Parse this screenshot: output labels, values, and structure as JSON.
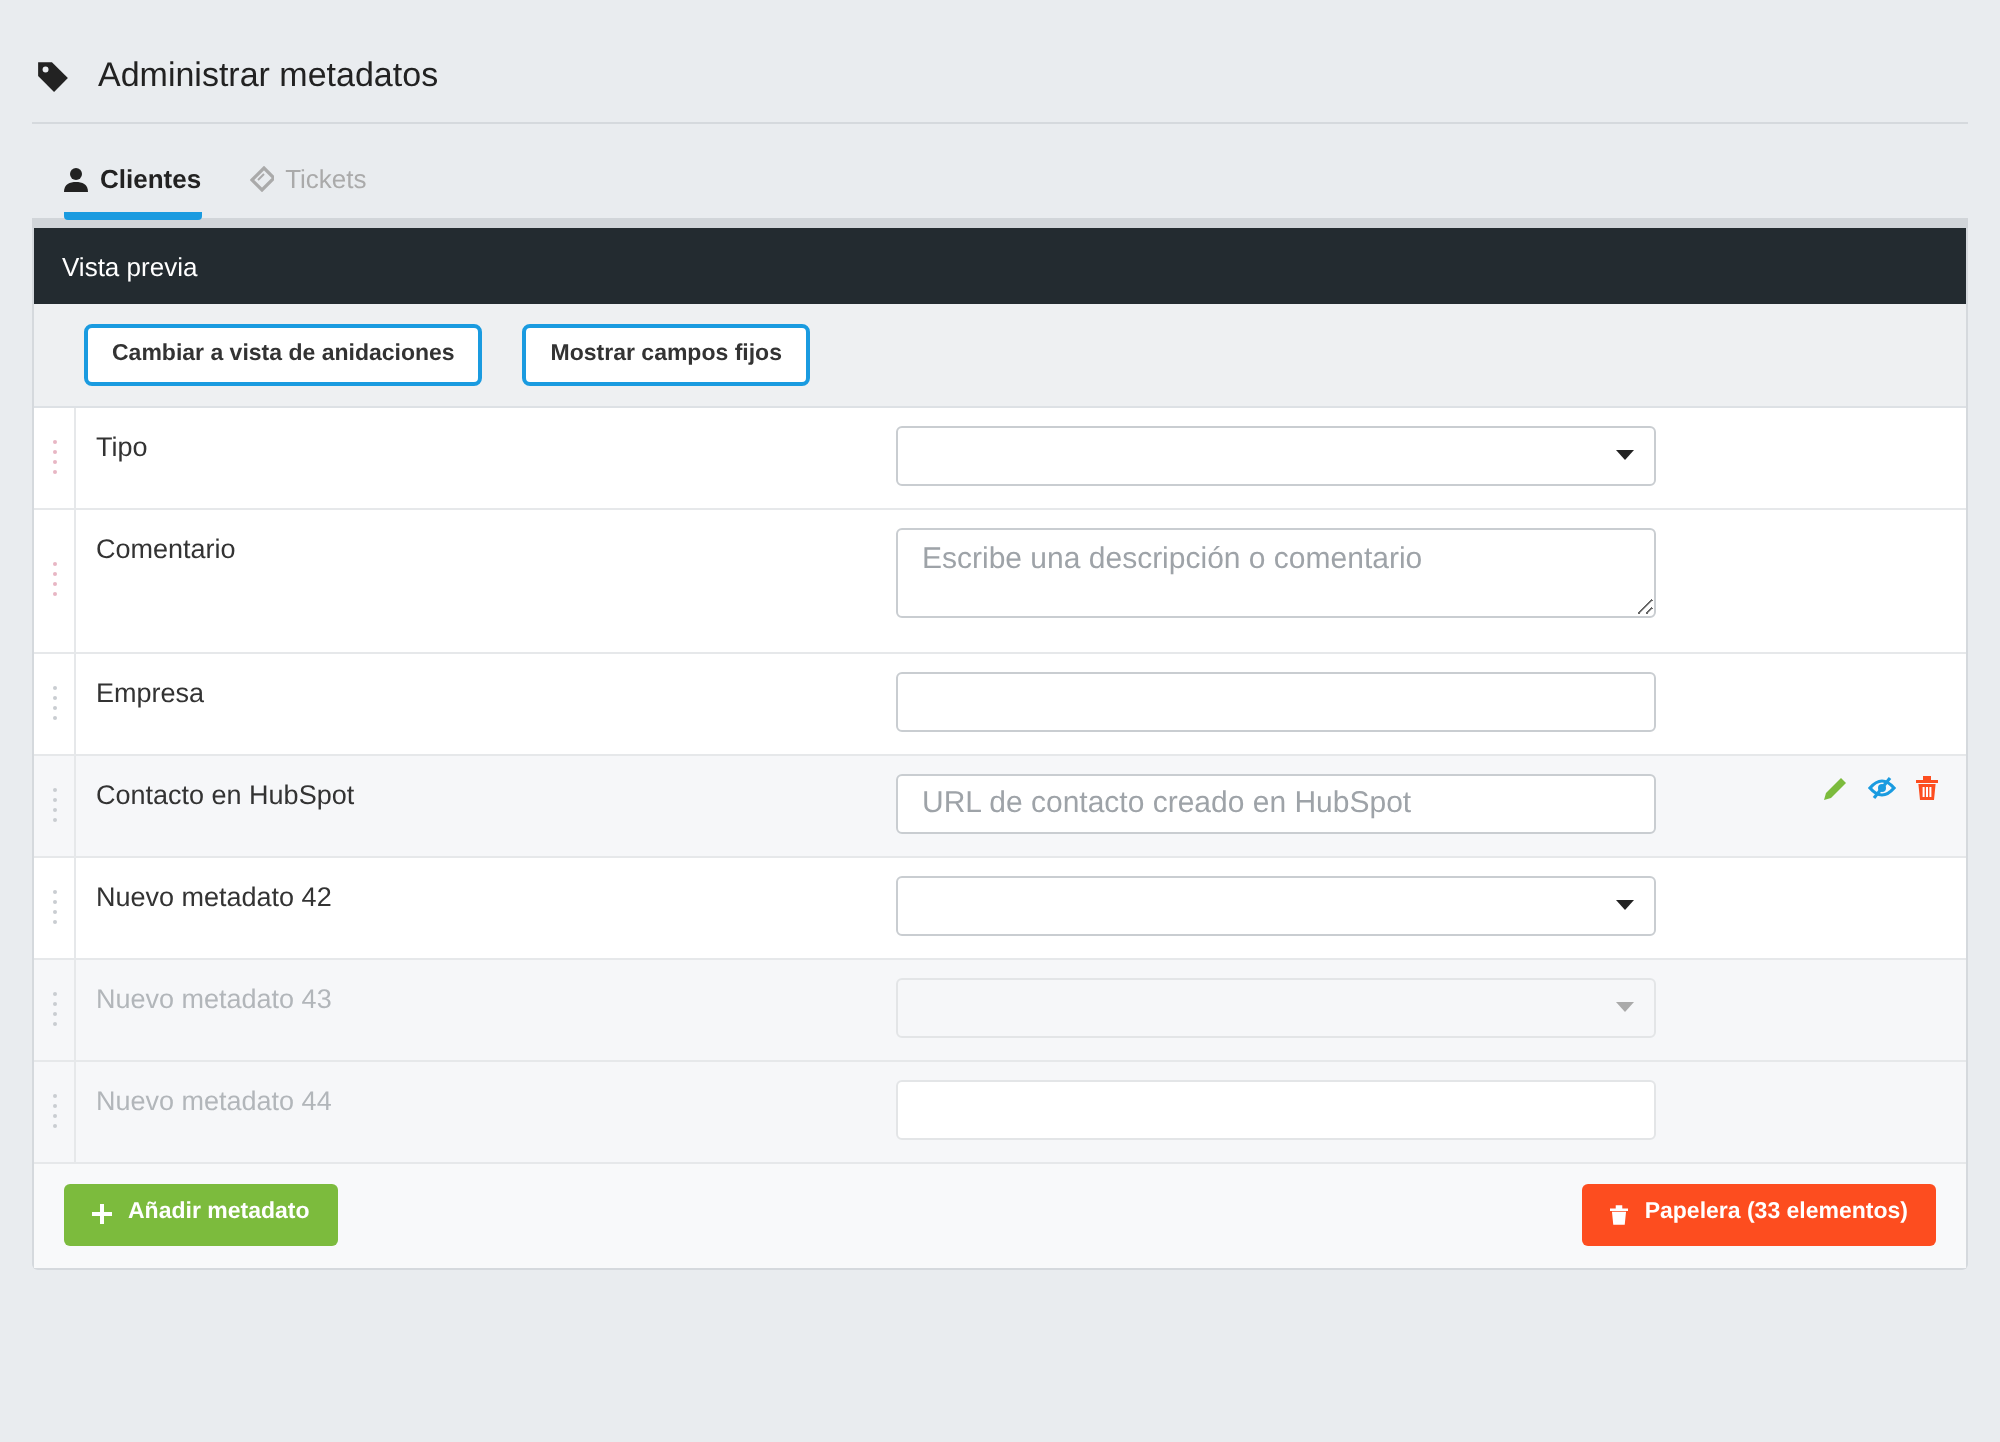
{
  "title": "Administrar metadatos",
  "tabs": [
    {
      "label": "Clientes",
      "kind": "user",
      "selected": true
    },
    {
      "label": "Tickets",
      "kind": "ticket",
      "selected": false
    }
  ],
  "preview_bar": "Vista previa",
  "toolbar_buttons": [
    "Cambiar a vista de anidaciones",
    "Mostrar campos fijos"
  ],
  "fields": [
    {
      "label": "Tipo",
      "kind": "select",
      "disabled": false,
      "hovered": false
    },
    {
      "label": "Comentario",
      "kind": "textarea",
      "placeholder": "Escribe una descripción o comentario",
      "disabled": false,
      "hovered": false
    },
    {
      "label": "Empresa",
      "kind": "text",
      "disabled": false,
      "hovered": false
    },
    {
      "label": "Contacto en HubSpot",
      "kind": "text",
      "placeholder": "URL de contacto creado en HubSpot",
      "disabled": false,
      "hovered": true
    },
    {
      "label": "Nuevo metadato 42",
      "kind": "select",
      "disabled": false,
      "hovered": false
    },
    {
      "label": "Nuevo metadato 43",
      "kind": "select",
      "disabled": true,
      "hovered": false
    },
    {
      "label": "Nuevo metadato 44",
      "kind": "text",
      "disabled": true,
      "hovered": false
    }
  ],
  "add_button": "Añadir metadato",
  "trash_button": "Papelera (33 elementos)"
}
